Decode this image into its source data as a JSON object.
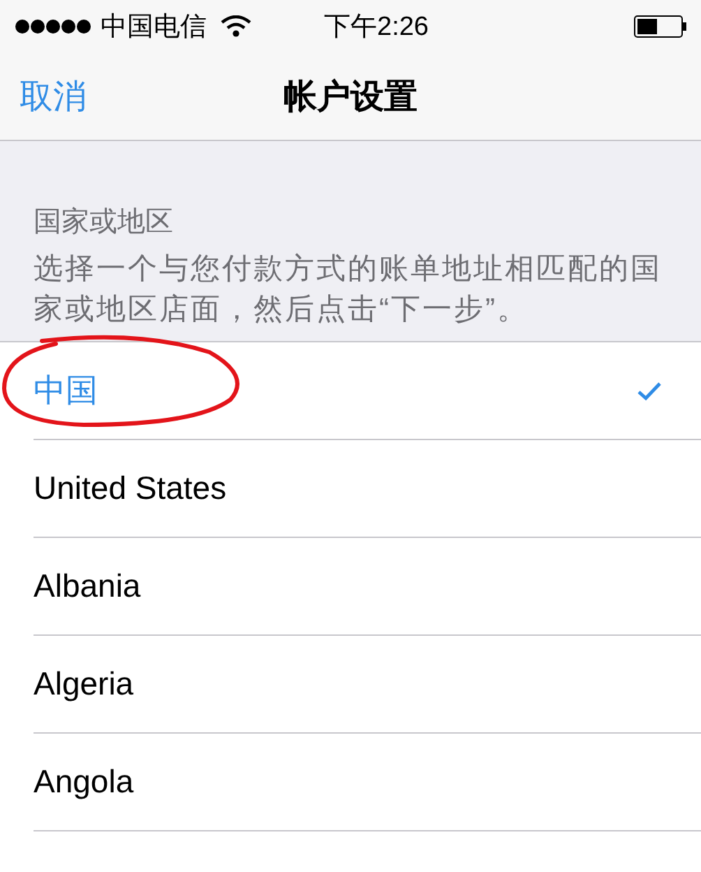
{
  "status_bar": {
    "carrier": "中国电信",
    "time": "下午2:26"
  },
  "nav_bar": {
    "cancel": "取消",
    "title": "帐户设置"
  },
  "section": {
    "header": "国家或地区",
    "description": "选择一个与您付款方式的账单地址相匹配的国家或地区店面，然后点击“下一步”。"
  },
  "countries": [
    {
      "name": "中国",
      "selected": true
    },
    {
      "name": "United States",
      "selected": false
    },
    {
      "name": "Albania",
      "selected": false
    },
    {
      "name": "Algeria",
      "selected": false
    },
    {
      "name": "Angola",
      "selected": false
    }
  ],
  "hand_drawn_circle": true
}
